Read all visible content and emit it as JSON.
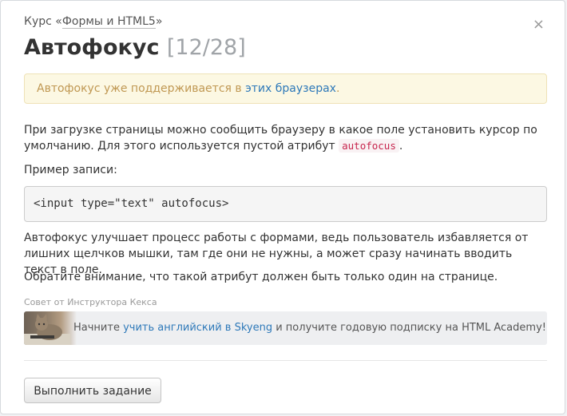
{
  "header": {
    "course_prefix": "Курс «",
    "course_name": "Формы и HTML5",
    "course_suffix": "»",
    "title": "Автофокус",
    "counter": "[12/28]",
    "close_symbol": "×"
  },
  "alert": {
    "text_before": "Автофокус уже поддерживается в ",
    "link_text": "этих браузерах",
    "text_after": "."
  },
  "content": {
    "intro_before": "При загрузке страницы можно сообщить браузеру в какое поле установить курсор по умолчанию. Для этого используется пустой атрибут ",
    "intro_code": "autofocus",
    "intro_after": ".",
    "example_label": "Пример записи:",
    "code_sample": "<input type=\"text\" autofocus>",
    "benefit": "Автофокус улучшает процесс работы с формами, ведь пользователь избавляется от лишних щелчков мышки, там где они не нужны, а может сразу начинать вводить текст в поле.",
    "note": "Обратите внимание, что такой атрибут должен быть только один на странице."
  },
  "tip": {
    "label": "Совет от Инструктора Кекса",
    "text_before": "Начните ",
    "link_text": "учить английский в Skyeng",
    "text_after": " и получите годовую подписку на HTML Academy!"
  },
  "actions": {
    "submit_label": "Выполнить задание"
  },
  "icons": {
    "close": "close-icon",
    "avatar": "cat-avatar"
  }
}
